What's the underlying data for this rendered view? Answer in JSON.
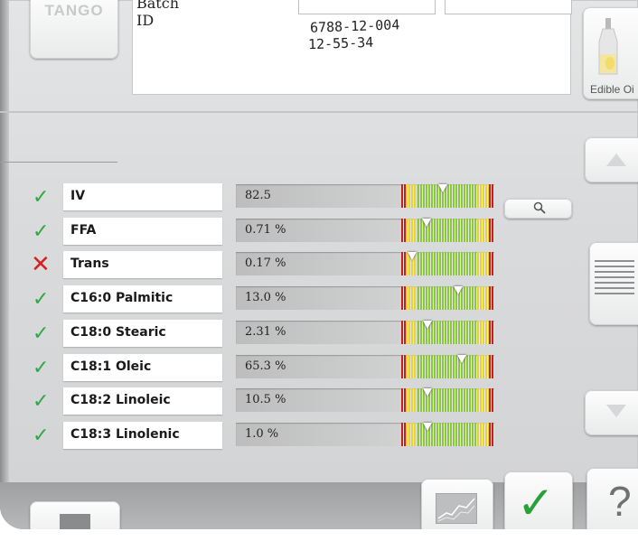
{
  "brand": {
    "name": "TANGO"
  },
  "sample": {
    "batch_label": "Batch",
    "id_label": "ID",
    "batch_value": "6788-12-004",
    "id_value": "12-55-34"
  },
  "product": {
    "label": "Edible Oi",
    "icon": "oil-bottle-icon"
  },
  "colors": {
    "pass": "#2ea845",
    "fail": "#d62020",
    "red_zone": "#c4201c",
    "yellow_zone": "#e8d23a",
    "green_zone": "#8dc63f"
  },
  "results": [
    {
      "name": "IV",
      "value": "82.5",
      "status": "pass",
      "position": 0.45
    },
    {
      "name": "FFA",
      "value": "0.71 %",
      "status": "pass",
      "position": 0.27
    },
    {
      "name": "Trans",
      "value": "0.17 %",
      "status": "fail",
      "position": 0.12
    },
    {
      "name": "C16:0 Palmitic",
      "value": "13.0 %",
      "status": "pass",
      "position": 0.62
    },
    {
      "name": "C18:0 Stearic",
      "value": "2.31 %",
      "status": "pass",
      "position": 0.28
    },
    {
      "name": "C18:1 Oleic",
      "value": "65.3 %",
      "status": "pass",
      "position": 0.66
    },
    {
      "name": "C18:2 Linoleic",
      "value": "10.5 %",
      "status": "pass",
      "position": 0.28
    },
    {
      "name": "C18:3 Linolenic",
      "value": "1.0 %",
      "status": "pass",
      "position": 0.28
    }
  ],
  "buttons": {
    "search_icon": "magnifier-icon",
    "scroll_up_icon": "arrow-up-icon",
    "scroll_down_icon": "arrow-down-icon",
    "report_icon": "report-icon",
    "trend_icon": "trend-chart-icon",
    "accept_icon": "checkmark-icon",
    "help_label": "?"
  }
}
